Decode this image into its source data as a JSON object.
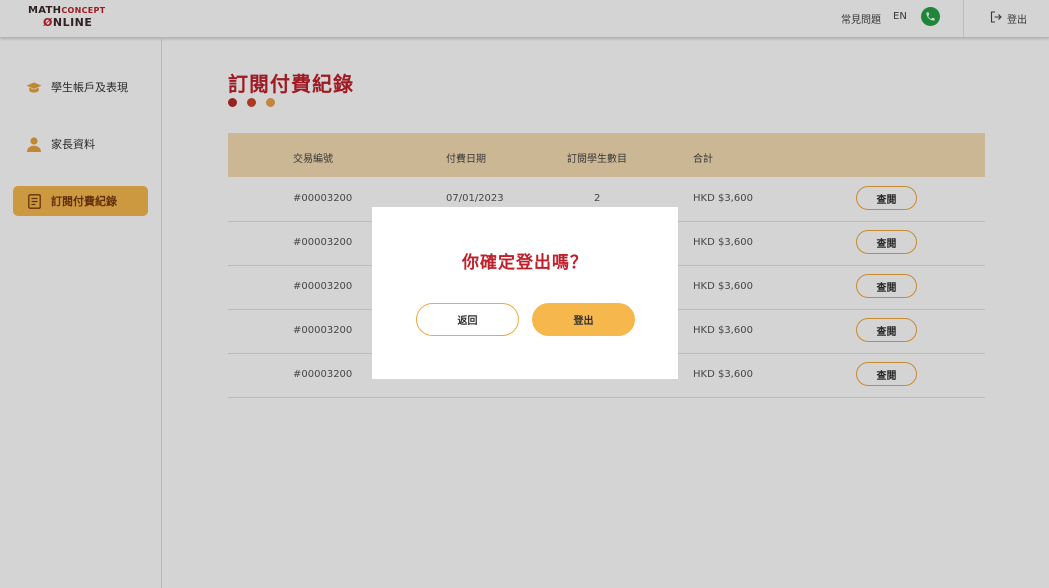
{
  "header": {
    "logo_line1_a": "MATH",
    "logo_line1_b": "CONCEPT",
    "logo_line2_a": "Ø",
    "logo_line2_b": "NLINE",
    "faq": "常見問題",
    "lang": "EN",
    "logout": "登出"
  },
  "sidebar": {
    "items": [
      {
        "label": "學生帳戶及表現",
        "icon": "graduation-cap-icon",
        "active": false
      },
      {
        "label": "家長資料",
        "icon": "user-icon",
        "active": false
      },
      {
        "label": "訂閱付費紀錄",
        "icon": "document-icon",
        "active": true
      }
    ]
  },
  "main": {
    "title": "訂閱付費紀錄",
    "dot_colors": [
      "#b8282a",
      "#d2452b",
      "#e8a04a"
    ],
    "columns": [
      "交易編號",
      "付費日期",
      "訂閱學生數目",
      "合計"
    ],
    "rows": [
      {
        "id": "#00003200",
        "date": "07/01/2023",
        "count": "2",
        "total": "HKD $3,600",
        "action": "查閱"
      },
      {
        "id": "#00003200",
        "date": "",
        "count": "",
        "total": "HKD $3,600",
        "action": "查閱"
      },
      {
        "id": "#00003200",
        "date": "",
        "count": "",
        "total": "HKD $3,600",
        "action": "查閱"
      },
      {
        "id": "#00003200",
        "date": "",
        "count": "",
        "total": "HKD $3,600",
        "action": "查閱"
      },
      {
        "id": "#00003200",
        "date": "",
        "count": "",
        "total": "HKD $3,600",
        "action": "查閱"
      }
    ]
  },
  "modal": {
    "title": "你確定登出嗎？",
    "back_label": "返回",
    "logout_label": "登出"
  },
  "colors": {
    "accent": "#f6b74d",
    "brand_red": "#c0202a",
    "table_head": "#f5dcb3"
  }
}
